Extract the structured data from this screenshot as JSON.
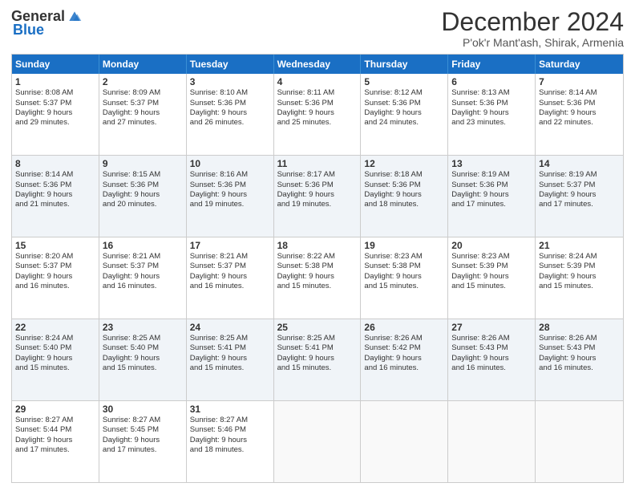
{
  "logo": {
    "general": "General",
    "blue": "Blue"
  },
  "title": "December 2024",
  "subtitle": "P'ok'r Mant'ash, Shirak, Armenia",
  "headers": [
    "Sunday",
    "Monday",
    "Tuesday",
    "Wednesday",
    "Thursday",
    "Friday",
    "Saturday"
  ],
  "rows": [
    [
      {
        "day": "1",
        "lines": [
          "Sunrise: 8:08 AM",
          "Sunset: 5:37 PM",
          "Daylight: 9 hours",
          "and 29 minutes."
        ]
      },
      {
        "day": "2",
        "lines": [
          "Sunrise: 8:09 AM",
          "Sunset: 5:37 PM",
          "Daylight: 9 hours",
          "and 27 minutes."
        ]
      },
      {
        "day": "3",
        "lines": [
          "Sunrise: 8:10 AM",
          "Sunset: 5:36 PM",
          "Daylight: 9 hours",
          "and 26 minutes."
        ]
      },
      {
        "day": "4",
        "lines": [
          "Sunrise: 8:11 AM",
          "Sunset: 5:36 PM",
          "Daylight: 9 hours",
          "and 25 minutes."
        ]
      },
      {
        "day": "5",
        "lines": [
          "Sunrise: 8:12 AM",
          "Sunset: 5:36 PM",
          "Daylight: 9 hours",
          "and 24 minutes."
        ]
      },
      {
        "day": "6",
        "lines": [
          "Sunrise: 8:13 AM",
          "Sunset: 5:36 PM",
          "Daylight: 9 hours",
          "and 23 minutes."
        ]
      },
      {
        "day": "7",
        "lines": [
          "Sunrise: 8:14 AM",
          "Sunset: 5:36 PM",
          "Daylight: 9 hours",
          "and 22 minutes."
        ]
      }
    ],
    [
      {
        "day": "8",
        "lines": [
          "Sunrise: 8:14 AM",
          "Sunset: 5:36 PM",
          "Daylight: 9 hours",
          "and 21 minutes."
        ]
      },
      {
        "day": "9",
        "lines": [
          "Sunrise: 8:15 AM",
          "Sunset: 5:36 PM",
          "Daylight: 9 hours",
          "and 20 minutes."
        ]
      },
      {
        "day": "10",
        "lines": [
          "Sunrise: 8:16 AM",
          "Sunset: 5:36 PM",
          "Daylight: 9 hours",
          "and 19 minutes."
        ]
      },
      {
        "day": "11",
        "lines": [
          "Sunrise: 8:17 AM",
          "Sunset: 5:36 PM",
          "Daylight: 9 hours",
          "and 19 minutes."
        ]
      },
      {
        "day": "12",
        "lines": [
          "Sunrise: 8:18 AM",
          "Sunset: 5:36 PM",
          "Daylight: 9 hours",
          "and 18 minutes."
        ]
      },
      {
        "day": "13",
        "lines": [
          "Sunrise: 8:19 AM",
          "Sunset: 5:36 PM",
          "Daylight: 9 hours",
          "and 17 minutes."
        ]
      },
      {
        "day": "14",
        "lines": [
          "Sunrise: 8:19 AM",
          "Sunset: 5:37 PM",
          "Daylight: 9 hours",
          "and 17 minutes."
        ]
      }
    ],
    [
      {
        "day": "15",
        "lines": [
          "Sunrise: 8:20 AM",
          "Sunset: 5:37 PM",
          "Daylight: 9 hours",
          "and 16 minutes."
        ]
      },
      {
        "day": "16",
        "lines": [
          "Sunrise: 8:21 AM",
          "Sunset: 5:37 PM",
          "Daylight: 9 hours",
          "and 16 minutes."
        ]
      },
      {
        "day": "17",
        "lines": [
          "Sunrise: 8:21 AM",
          "Sunset: 5:37 PM",
          "Daylight: 9 hours",
          "and 16 minutes."
        ]
      },
      {
        "day": "18",
        "lines": [
          "Sunrise: 8:22 AM",
          "Sunset: 5:38 PM",
          "Daylight: 9 hours",
          "and 15 minutes."
        ]
      },
      {
        "day": "19",
        "lines": [
          "Sunrise: 8:23 AM",
          "Sunset: 5:38 PM",
          "Daylight: 9 hours",
          "and 15 minutes."
        ]
      },
      {
        "day": "20",
        "lines": [
          "Sunrise: 8:23 AM",
          "Sunset: 5:39 PM",
          "Daylight: 9 hours",
          "and 15 minutes."
        ]
      },
      {
        "day": "21",
        "lines": [
          "Sunrise: 8:24 AM",
          "Sunset: 5:39 PM",
          "Daylight: 9 hours",
          "and 15 minutes."
        ]
      }
    ],
    [
      {
        "day": "22",
        "lines": [
          "Sunrise: 8:24 AM",
          "Sunset: 5:40 PM",
          "Daylight: 9 hours",
          "and 15 minutes."
        ]
      },
      {
        "day": "23",
        "lines": [
          "Sunrise: 8:25 AM",
          "Sunset: 5:40 PM",
          "Daylight: 9 hours",
          "and 15 minutes."
        ]
      },
      {
        "day": "24",
        "lines": [
          "Sunrise: 8:25 AM",
          "Sunset: 5:41 PM",
          "Daylight: 9 hours",
          "and 15 minutes."
        ]
      },
      {
        "day": "25",
        "lines": [
          "Sunrise: 8:25 AM",
          "Sunset: 5:41 PM",
          "Daylight: 9 hours",
          "and 15 minutes."
        ]
      },
      {
        "day": "26",
        "lines": [
          "Sunrise: 8:26 AM",
          "Sunset: 5:42 PM",
          "Daylight: 9 hours",
          "and 16 minutes."
        ]
      },
      {
        "day": "27",
        "lines": [
          "Sunrise: 8:26 AM",
          "Sunset: 5:43 PM",
          "Daylight: 9 hours",
          "and 16 minutes."
        ]
      },
      {
        "day": "28",
        "lines": [
          "Sunrise: 8:26 AM",
          "Sunset: 5:43 PM",
          "Daylight: 9 hours",
          "and 16 minutes."
        ]
      }
    ],
    [
      {
        "day": "29",
        "lines": [
          "Sunrise: 8:27 AM",
          "Sunset: 5:44 PM",
          "Daylight: 9 hours",
          "and 17 minutes."
        ]
      },
      {
        "day": "30",
        "lines": [
          "Sunrise: 8:27 AM",
          "Sunset: 5:45 PM",
          "Daylight: 9 hours",
          "and 17 minutes."
        ]
      },
      {
        "day": "31",
        "lines": [
          "Sunrise: 8:27 AM",
          "Sunset: 5:46 PM",
          "Daylight: 9 hours",
          "and 18 minutes."
        ]
      },
      {
        "day": "",
        "lines": []
      },
      {
        "day": "",
        "lines": []
      },
      {
        "day": "",
        "lines": []
      },
      {
        "day": "",
        "lines": []
      }
    ]
  ],
  "alt_rows": [
    1,
    3
  ]
}
